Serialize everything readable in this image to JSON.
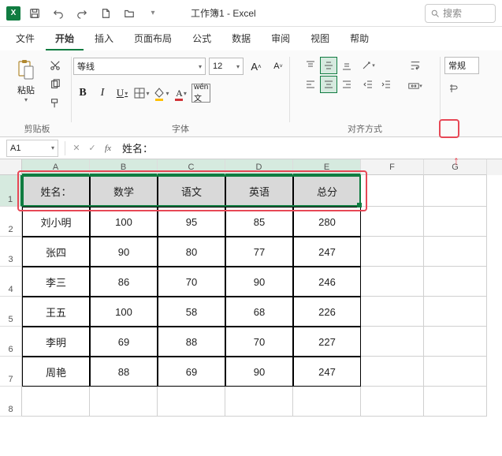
{
  "app": {
    "title": "工作簿1 - Excel"
  },
  "search": {
    "placeholder": "搜索"
  },
  "tabs": {
    "file": "文件",
    "home": "开始",
    "insert": "插入",
    "layout": "页面布局",
    "formulas": "公式",
    "data": "数据",
    "review": "审阅",
    "view": "视图",
    "help": "帮助"
  },
  "ribbon": {
    "clipboard": {
      "label": "剪贴板",
      "paste": "粘贴"
    },
    "font": {
      "label": "字体",
      "name": "等线",
      "size": "12"
    },
    "alignment": {
      "label": "对齐方式"
    },
    "number": {
      "label": "常规"
    }
  },
  "namebox": "A1",
  "formula_value": "姓名：",
  "columns": [
    "A",
    "B",
    "C",
    "D",
    "E",
    "F",
    "G"
  ],
  "selected_cols": [
    "A",
    "B",
    "C",
    "D",
    "E"
  ],
  "rows": [
    1,
    2,
    3,
    4,
    5,
    6,
    7,
    8
  ],
  "selected_row": 1,
  "table": {
    "headers": [
      "姓名：",
      "数学",
      "语文",
      "英语",
      "总分"
    ],
    "rows": [
      [
        "刘小明",
        "100",
        "95",
        "85",
        "280"
      ],
      [
        "张四",
        "90",
        "80",
        "77",
        "247"
      ],
      [
        "李三",
        "86",
        "70",
        "90",
        "246"
      ],
      [
        "王五",
        "100",
        "58",
        "68",
        "226"
      ],
      [
        "李明",
        "69",
        "88",
        "70",
        "227"
      ],
      [
        "周艳",
        "88",
        "69",
        "90",
        "247"
      ]
    ]
  },
  "chart_data": {
    "type": "table",
    "title": "",
    "columns": [
      "姓名：",
      "数学",
      "语文",
      "英语",
      "总分"
    ],
    "rows": [
      {
        "姓名：": "刘小明",
        "数学": 100,
        "语文": 95,
        "英语": 85,
        "总分": 280
      },
      {
        "姓名：": "张四",
        "数学": 90,
        "语文": 80,
        "英语": 77,
        "总分": 247
      },
      {
        "姓名：": "李三",
        "数学": 86,
        "语文": 70,
        "英语": 90,
        "总分": 246
      },
      {
        "姓名：": "王五",
        "数学": 100,
        "语文": 58,
        "英语": 68,
        "总分": 226
      },
      {
        "姓名：": "李明",
        "数学": 69,
        "语文": 88,
        "英语": 70,
        "总分": 227
      },
      {
        "姓名：": "周艳",
        "数学": 88,
        "语文": 69,
        "英语": 90,
        "总分": 247
      }
    ]
  }
}
